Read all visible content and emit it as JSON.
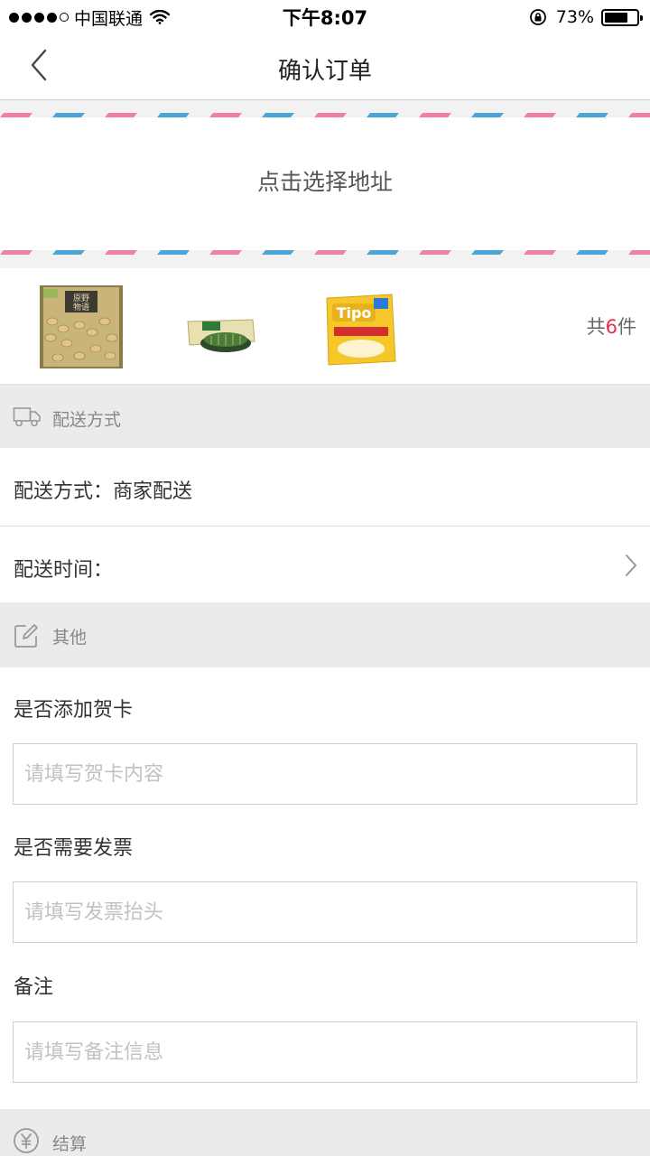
{
  "status_bar": {
    "carrier": "中国联通",
    "time": "下午8:07",
    "battery": "73%",
    "battery_level": 0.73
  },
  "nav": {
    "title": "确认订单",
    "back_icon": "chevron-left-icon"
  },
  "address": {
    "prompt": "点击选择地址",
    "stripe_colors": [
      "#4aa5d8",
      "#ef7fa3"
    ]
  },
  "products": {
    "count_prefix": "共",
    "count_number": "6",
    "count_suffix": "件",
    "items": [
      "peanut-snack",
      "seaweed-snack",
      "tipo-biscuit"
    ]
  },
  "delivery": {
    "section_title": "配送方式",
    "method_label": "配送方式：",
    "method_value": "商家配送",
    "time_label": "配送时间："
  },
  "other": {
    "section_title": "其他",
    "greeting_card_label": "是否添加贺卡",
    "greeting_card_placeholder": "请填写贺卡内容",
    "invoice_label": "是否需要发票",
    "invoice_placeholder": "请填写发票抬头",
    "remark_label": "备注",
    "remark_placeholder": "请填写备注信息"
  },
  "checkout": {
    "section_title": "结算"
  },
  "colors": {
    "section_bg": "#ebebeb",
    "accent_red": "#e5304b"
  }
}
